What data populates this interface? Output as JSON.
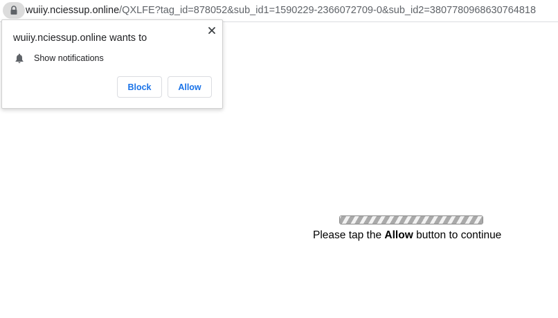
{
  "address_bar": {
    "host": "wuiiy.nciessup.online",
    "path": "/QXLFE?tag_id=878052&sub_id1=1590229-2366072709-0&sub_id2=3807780968630764818"
  },
  "permission_popup": {
    "title": "wuiiy.nciessup.online wants to",
    "permission_label": "Show notifications",
    "block_label": "Block",
    "allow_label": "Allow"
  },
  "page": {
    "progress_fraction": 1.0,
    "instruction_prefix": "Please tap the ",
    "instruction_bold": "Allow",
    "instruction_suffix": " button to continue"
  },
  "colors": {
    "accent": "#1a73e8",
    "lock_chip": "#dcdcdc"
  },
  "icons": {
    "lock": "lock-icon",
    "close": "close-icon",
    "bell": "bell-icon"
  }
}
